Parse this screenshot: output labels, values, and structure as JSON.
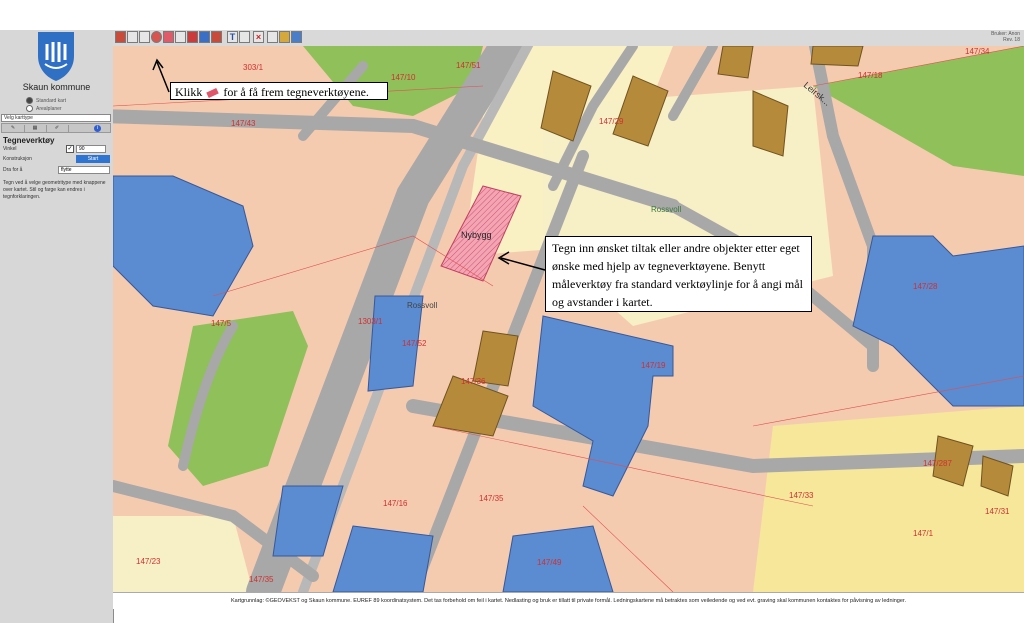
{
  "municipality": {
    "name": "Skaun kommune"
  },
  "base_map_options": [
    {
      "label": "Standard kart",
      "selected": true
    },
    {
      "label": "Arealplaner",
      "selected": false
    }
  ],
  "map_type_select": {
    "label": "Velg karttype"
  },
  "panel": {
    "title": "Tegneverktøy",
    "vinkel_label": "Vinkel",
    "vinkel_value": "90",
    "konstruksjon_label": "Konstruksjon",
    "start_label": "Start",
    "drafor_label": "Dra for å",
    "drafor_value": "flytte",
    "help": "Tegn ved å velge geometritype med knappene over kartet. Stil og farge kan endres i tegnforklaringen."
  },
  "toolbar": {
    "right_text_1": "Bruker: Anon",
    "right_text_2": "Rev. 18"
  },
  "map": {
    "parcels": [
      "303/1",
      "147/10",
      "147/51",
      "147/18",
      "147/43",
      "147/29",
      "147/23",
      "147/36",
      "147/19",
      "147/1",
      "147/28",
      "147/33",
      "147/16",
      "147/49",
      "147/35",
      "147/5",
      "147/31",
      "1303/1",
      "147/52",
      "147/35",
      "147/287",
      "147/34"
    ],
    "labels": {
      "nybygg": "Nybygg",
      "rossvoll_1": "Rossvoll",
      "rossvoll_2": "Rossvoll",
      "road": "Leirsk..."
    }
  },
  "callouts": {
    "toolbar_hint_before": "Klikk",
    "toolbar_hint_after": "for å få frem tegneverktøyene.",
    "main_hint": "Tegn inn ønsket tiltak eller andre objekter etter eget ønske med hjelp av tegneverktøyene. Benytt måleverktøy fra standard verktøylinje for å angi mål og avstander i kartet."
  },
  "footer": {
    "text": "Kartgrunnlag: ©GEOVEKST og Skaun kommune. EUREF 89 koordinatsystem. Det tas forbehold om feil i kartet. Nedlasting og bruk er tillatt til private formål. Ledningskartene må betraktes som veiledende og ved evt. graving skal kommunen kontaktes for påvisning av ledninger."
  },
  "colors": {
    "building_blue": "#5b8bd0",
    "building_brown": "#b58a3a",
    "green_area": "#8fc05a",
    "road": "#a9a9a9",
    "land": "#f5cbb0",
    "yellow_area": "#f7e9a0",
    "new_building": "#f0a0b0"
  }
}
